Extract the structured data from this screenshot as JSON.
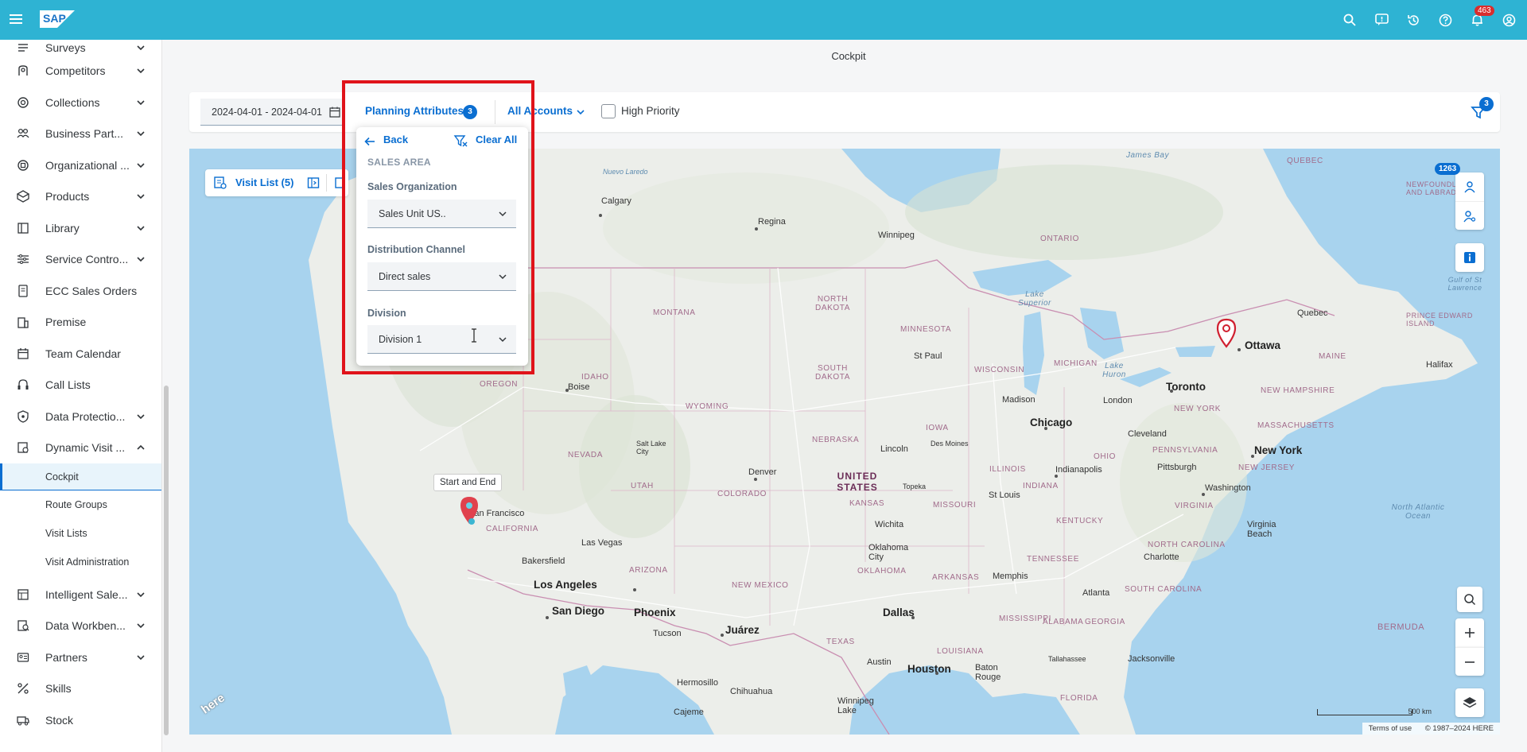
{
  "shell": {
    "logo": "SAP",
    "notifications_count": "463",
    "icons": [
      "search-icon",
      "feedback-icon",
      "history-icon",
      "help-icon",
      "notifications-icon",
      "user-icon"
    ]
  },
  "sidebar": {
    "items": [
      {
        "label": "Surveys",
        "icon": "surveys-icon",
        "expandable": true
      },
      {
        "label": "Competitors",
        "icon": "competitors-icon",
        "expandable": true
      },
      {
        "label": "Collections",
        "icon": "collections-icon",
        "expandable": true
      },
      {
        "label": "Business Part...",
        "icon": "business-partner-icon",
        "expandable": true
      },
      {
        "label": "Organizational ...",
        "icon": "org-icon",
        "expandable": true
      },
      {
        "label": "Products",
        "icon": "products-icon",
        "expandable": true
      },
      {
        "label": "Library",
        "icon": "library-icon",
        "expandable": true
      },
      {
        "label": "Service Contro...",
        "icon": "service-control-icon",
        "expandable": true
      },
      {
        "label": "ECC Sales Orders",
        "icon": "sales-orders-icon",
        "expandable": false
      },
      {
        "label": "Premise",
        "icon": "premise-icon",
        "expandable": false
      },
      {
        "label": "Team Calendar",
        "icon": "calendar-icon",
        "expandable": false
      },
      {
        "label": "Call Lists",
        "icon": "call-lists-icon",
        "expandable": false
      },
      {
        "label": "Data Protectio...",
        "icon": "data-protection-icon",
        "expandable": true
      },
      {
        "label": "Dynamic Visit ...",
        "icon": "dynamic-visit-icon",
        "expandable": true,
        "expanded": true
      }
    ],
    "subitems": [
      "Cockpit",
      "Route Groups",
      "Visit Lists",
      "Visit Administration"
    ],
    "selected_subitem": "Cockpit",
    "items_after": [
      {
        "label": "Intelligent Sale...",
        "icon": "intelligent-sales-icon",
        "expandable": true
      },
      {
        "label": "Data Workben...",
        "icon": "data-workbench-icon",
        "expandable": true
      },
      {
        "label": "Partners",
        "icon": "partners-icon",
        "expandable": true
      },
      {
        "label": "Skills",
        "icon": "skills-icon",
        "expandable": false
      },
      {
        "label": "Stock",
        "icon": "stock-icon",
        "expandable": false
      }
    ]
  },
  "page": {
    "title": "Cockpit"
  },
  "filterbar": {
    "date_range": "2024-04-01 - 2024-04-01",
    "planning_attributes_label": "Planning Attributes",
    "planning_attributes_count": "3",
    "accounts_label": "All Accounts",
    "high_priority_label": "High Priority",
    "high_priority_checked": false,
    "filter_count": "3"
  },
  "popover": {
    "back_label": "Back",
    "clear_all_label": "Clear All",
    "section_title": "SALES AREA",
    "fields": [
      {
        "label": "Sales Organization",
        "value": "Sales Unit US.."
      },
      {
        "label": "Distribution Channel",
        "value": "Direct sales"
      },
      {
        "label": "Division",
        "value": "Division 1"
      }
    ]
  },
  "map": {
    "visit_list_label": "Visit List (5)",
    "accounts_count": "1263",
    "start_end_tooltip": "Start and End",
    "scale_label": "500 km",
    "terms_label": "Terms of use",
    "copyright": "© 1987–2024 HERE",
    "provider_logo": "here",
    "places": [
      {
        "name": "Calgary",
        "cls": "city"
      },
      {
        "name": "Regina",
        "cls": "city"
      },
      {
        "name": "Winnipeg",
        "cls": "city"
      },
      {
        "name": "ONTARIO",
        "cls": "state"
      },
      {
        "name": "James Bay",
        "cls": "water"
      },
      {
        "name": "QUEBEC",
        "cls": "state"
      },
      {
        "name": "NEWFOUNDLAND AND LABRADOR",
        "cls": "state"
      },
      {
        "name": "Quebec",
        "cls": "city"
      },
      {
        "name": "Ottawa",
        "cls": "big"
      },
      {
        "name": "Toronto",
        "cls": "big"
      },
      {
        "name": "Halifax",
        "cls": "city"
      },
      {
        "name": "MAINE",
        "cls": "state"
      },
      {
        "name": "NEW HAMPSHIRE",
        "cls": "state"
      },
      {
        "name": "MASSACHUSETTS",
        "cls": "state"
      },
      {
        "name": "NEW YORK",
        "cls": "state"
      },
      {
        "name": "New York",
        "cls": "big"
      },
      {
        "name": "PENNSYLVANIA",
        "cls": "state"
      },
      {
        "name": "NEW JERSEY",
        "cls": "state"
      },
      {
        "name": "Pittsburgh",
        "cls": "city"
      },
      {
        "name": "Washington",
        "cls": "city"
      },
      {
        "name": "VIRGINIA",
        "cls": "state"
      },
      {
        "name": "Virginia Beach",
        "cls": "city"
      },
      {
        "name": "NORTH CAROLINA",
        "cls": "state"
      },
      {
        "name": "SOUTH CAROLINA",
        "cls": "state"
      },
      {
        "name": "Charlotte",
        "cls": "city"
      },
      {
        "name": "Atlanta",
        "cls": "city"
      },
      {
        "name": "GEORGIA",
        "cls": "state"
      },
      {
        "name": "Jacksonville",
        "cls": "city"
      },
      {
        "name": "FLORIDA",
        "cls": "state"
      },
      {
        "name": "Tallahassee",
        "cls": "city"
      },
      {
        "name": "BERMUDA",
        "cls": "state"
      },
      {
        "name": "North Atlantic Ocean",
        "cls": "water"
      },
      {
        "name": "Gulf of St Lawrence",
        "cls": "water"
      },
      {
        "name": "PRINCE EDWARD ISLAND",
        "cls": "state"
      },
      {
        "name": "Cleveland",
        "cls": "city"
      },
      {
        "name": "London",
        "cls": "city"
      },
      {
        "name": "Lake Huron",
        "cls": "water"
      },
      {
        "name": "MICHIGAN",
        "cls": "state"
      },
      {
        "name": "Lake Superior",
        "cls": "water"
      },
      {
        "name": "Chicago",
        "cls": "big"
      },
      {
        "name": "Madison",
        "cls": "city"
      },
      {
        "name": "WISCONSIN",
        "cls": "state"
      },
      {
        "name": "MINNESOTA",
        "cls": "state"
      },
      {
        "name": "St Paul",
        "cls": "city"
      },
      {
        "name": "Indianapolis",
        "cls": "city"
      },
      {
        "name": "ILLINOIS",
        "cls": "state"
      },
      {
        "name": "INDIANA",
        "cls": "state"
      },
      {
        "name": "OHIO",
        "cls": "state"
      },
      {
        "name": "KENTUCKY",
        "cls": "state"
      },
      {
        "name": "TENNESSEE",
        "cls": "state"
      },
      {
        "name": "Memphis",
        "cls": "city"
      },
      {
        "name": "MISSISSIPPI",
        "cls": "state"
      },
      {
        "name": "ALABAMA",
        "cls": "state"
      },
      {
        "name": "LOUISIANA",
        "cls": "state"
      },
      {
        "name": "Baton Rouge",
        "cls": "city"
      },
      {
        "name": "Houston",
        "cls": "big"
      },
      {
        "name": "Austin",
        "cls": "city"
      },
      {
        "name": "TEXAS",
        "cls": "state"
      },
      {
        "name": "Dallas",
        "cls": "big"
      },
      {
        "name": "ARKANSAS",
        "cls": "state"
      },
      {
        "name": "OKLAHOMA",
        "cls": "state"
      },
      {
        "name": "Oklahoma City",
        "cls": "city"
      },
      {
        "name": "Wichita",
        "cls": "city"
      },
      {
        "name": "KANSAS",
        "cls": "state"
      },
      {
        "name": "MISSOURI",
        "cls": "state"
      },
      {
        "name": "St Louis",
        "cls": "city"
      },
      {
        "name": "Topeka",
        "cls": "city"
      },
      {
        "name": "UNITED STATES",
        "cls": "country"
      },
      {
        "name": "NEBRASKA",
        "cls": "state"
      },
      {
        "name": "Lincoln",
        "cls": "city"
      },
      {
        "name": "IOWA",
        "cls": "state"
      },
      {
        "name": "Des Moines",
        "cls": "city"
      },
      {
        "name": "SOUTH DAKOTA",
        "cls": "state"
      },
      {
        "name": "NORTH DAKOTA",
        "cls": "state"
      },
      {
        "name": "MONTANA",
        "cls": "state"
      },
      {
        "name": "WYOMING",
        "cls": "state"
      },
      {
        "name": "Denver",
        "cls": "city"
      },
      {
        "name": "COLORADO",
        "cls": "state"
      },
      {
        "name": "NEW MEXICO",
        "cls": "state"
      },
      {
        "name": "Juárez",
        "cls": "big"
      },
      {
        "name": "Chihuahua",
        "cls": "city"
      },
      {
        "name": "Hermosillo",
        "cls": "city"
      },
      {
        "name": "Cajeme",
        "cls": "city"
      },
      {
        "name": "Tucson",
        "cls": "city"
      },
      {
        "name": "Phoenix",
        "cls": "big"
      },
      {
        "name": "ARIZONA",
        "cls": "state"
      },
      {
        "name": "UTAH",
        "cls": "state"
      },
      {
        "name": "Salt Lake City",
        "cls": "city"
      },
      {
        "name": "NEVADA",
        "cls": "state"
      },
      {
        "name": "Las Vegas",
        "cls": "city"
      },
      {
        "name": "Los Angeles",
        "cls": "big"
      },
      {
        "name": "San Diego",
        "cls": "big"
      },
      {
        "name": "Bakersfield",
        "cls": "city"
      },
      {
        "name": "CALIFORNIA",
        "cls": "state"
      },
      {
        "name": "San Francisco",
        "cls": "city"
      },
      {
        "name": "IDAHO",
        "cls": "state"
      },
      {
        "name": "Boise",
        "cls": "city"
      },
      {
        "name": "OREGON",
        "cls": "state"
      },
      {
        "name": "Nuevo Laredo",
        "cls": "city"
      },
      {
        "name": "Winnipeg Lake",
        "cls": "water"
      }
    ]
  },
  "colors": {
    "shell": "#2eb3d3",
    "accent": "#0a6ed1",
    "highlight_box": "#e0131a",
    "land": "#eceeea",
    "water": "#a8d3ee"
  }
}
